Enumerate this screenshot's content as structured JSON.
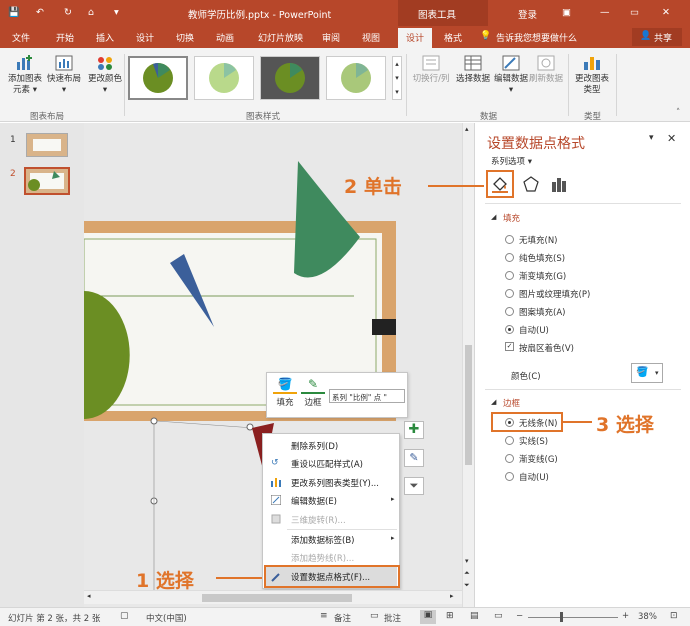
{
  "titlebar": {
    "title": "教师学历比例.pptx - PowerPoint",
    "context_tab": "图表工具",
    "login": "登录",
    "minimize": "—",
    "restore": "▭",
    "close": "✕",
    "bg_color": "#b7472a"
  },
  "tabs": [
    "文件",
    "开始",
    "插入",
    "设计",
    "切换",
    "动画",
    "幻灯片放映",
    "审阅",
    "视图",
    "设计",
    "格式"
  ],
  "tell_me": "告诉我您想要做什么",
  "share": "共享",
  "ribbon": {
    "add_element": "添加图表元素",
    "quick_layout": "快速布局",
    "change_colors": "更改颜色",
    "group_layout": "图表布局",
    "group_styles": "图表样式",
    "switch_row_col": "切换行/列",
    "select_data": "选择数据",
    "edit_data": "编辑数据",
    "refresh_data": "刷新数据",
    "group_data": "数据",
    "change_type": "更改图表类型",
    "group_type": "类型"
  },
  "thumbs": [
    {
      "num": "1"
    },
    {
      "num": "2"
    }
  ],
  "float_toolbar": {
    "fill": "填充",
    "outline": "边框",
    "series_select": "系列 \"比例\" 点 \""
  },
  "context_menu": [
    {
      "label": "删除系列(D)",
      "disabled": false
    },
    {
      "label": "重设以匹配样式(A)",
      "disabled": false
    },
    {
      "label": "更改系列图表类型(Y)...",
      "disabled": false
    },
    {
      "label": "编辑数据(E)",
      "disabled": false
    },
    {
      "label": "三维旋转(R)...",
      "disabled": true
    },
    {
      "label": "添加数据标签(B)",
      "disabled": false
    },
    {
      "label": "添加趋势线(R)...",
      "disabled": true
    },
    {
      "label": "设置数据点格式(F)...",
      "disabled": false
    }
  ],
  "pane": {
    "title": "设置数据点格式",
    "series_options": "系列选项",
    "fill_section": "填充",
    "fill_options": [
      "无填充(N)",
      "纯色填充(S)",
      "渐变填充(G)",
      "图片或纹理填充(P)",
      "图案填充(A)",
      "自动(U)"
    ],
    "vary_colors": "按扇区着色(V)",
    "color_label": "颜色(C)",
    "border_section": "边框",
    "border_options": [
      "无线条(N)",
      "实线(S)",
      "渐变线(G)",
      "自动(U)"
    ]
  },
  "callouts": {
    "step1": "1 选择",
    "step2": "2 单击",
    "step3": "3 选择"
  },
  "status": {
    "slide_info": "幻灯片 第 2 张，共 2 张",
    "language": "中文(中国)",
    "notes": "备注",
    "comments": "批注",
    "zoom": "38%"
  },
  "colors": {
    "accent": "#b7472a",
    "callout": "#e0742a",
    "pie_green": "#3f8a5e",
    "pie_olive": "#6b8e23",
    "pie_blue": "#3b5f9a",
    "pie_red": "#8b2020"
  }
}
